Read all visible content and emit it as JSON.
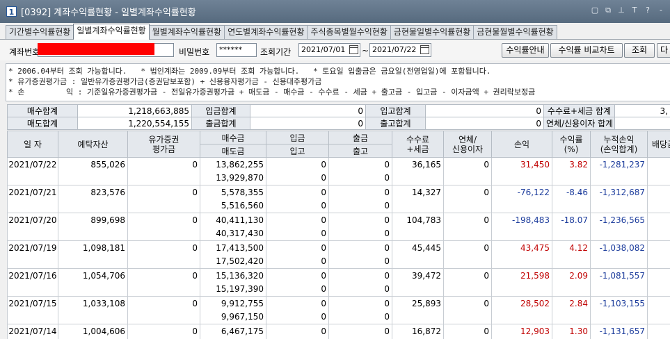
{
  "window": {
    "number": "1",
    "title": "[0392] 계좌수익률현황 - 일별계좌수익률현황",
    "tool_icons": [
      "▢",
      "⧉",
      "⊥",
      "T",
      "?",
      "-"
    ]
  },
  "tabs": [
    {
      "label": "기간별수익률현황",
      "active": false
    },
    {
      "label": "일별계좌수익률현황",
      "active": true
    },
    {
      "label": "월별계좌수익률현황",
      "active": false
    },
    {
      "label": "연도별계좌수익률현황",
      "active": false
    },
    {
      "label": "주식종목별월수익현황",
      "active": false
    },
    {
      "label": "금현물일별수익률현황",
      "active": false
    },
    {
      "label": "금현물월별수익률현황",
      "active": false
    }
  ],
  "search": {
    "account_label": "계좌번호",
    "password_label": "비밀번호",
    "password_value": "******",
    "period_label": "조회기간",
    "date_from": "2021/07/01",
    "date_sep": "~",
    "date_to": "2021/07/22",
    "guide_button": "수익률안내",
    "compare_button": "수익률 비교차트",
    "query_button": "조회",
    "next_button": "다"
  },
  "notes": [
    "* 2006.04부터 조회 가능합니다.   * 법인계좌는 2009.09부터 조회 가능합니다.   * 토요일 입출금은 금요일(전영업일)에 포함됩니다.",
    "* 유가증권평가금 : 일반유가증권평가금(증권담보포함) + 신용융자평가금 - 신용대주평가금",
    "* 손         익 : 기준일유가증권평가금 - 전일유가증권평가금 + 매도금 - 매수금 - 수수료 - 세금 + 출고금 - 입고금 - 이자금액 + 권리락보정금"
  ],
  "summary": {
    "row1": [
      {
        "label": "매수합계",
        "value": "1,218,663,885"
      },
      {
        "label": "입금합계",
        "value": "0"
      },
      {
        "label": "입고합계",
        "value": "0"
      },
      {
        "label": "수수료+세금 합계",
        "value": "3,"
      }
    ],
    "row2": [
      {
        "label": "매도합계",
        "value": "1,220,554,155"
      },
      {
        "label": "출금합계",
        "value": "0"
      },
      {
        "label": "출고합계",
        "value": "0"
      },
      {
        "label": "연체/신용이자 합계",
        "value": ""
      }
    ]
  },
  "grid": {
    "headers": {
      "date": "일 자",
      "deposit": "예탁자산",
      "securities": "유가증권\n평가금",
      "buy": "매수금",
      "sell": "매도금",
      "deposit_in": "입금",
      "securities_in": "입고",
      "withdraw": "출금",
      "securities_out": "출고",
      "fee": "수수료\n+세금",
      "interest": "연체/\n신용이자",
      "profit": "손익",
      "rate": "수익률\n(%)",
      "cumulative": "누적손익\n(손익합계)",
      "dividend": "배당금액"
    },
    "rows": [
      {
        "date": "2021/07/22",
        "deposit": "855,026",
        "securities": "0",
        "buy": "13,862,255",
        "sell": "13,929,870",
        "in": "0",
        "in2": "0",
        "out": "0",
        "out2": "0",
        "fee": "36,165",
        "interest": "0",
        "profit": "31,450",
        "rate": "3.82",
        "cumulative": "-1,281,237",
        "dividend": "",
        "sign": "pos"
      },
      {
        "date": "2021/07/21",
        "deposit": "823,576",
        "securities": "0",
        "buy": "5,578,355",
        "sell": "5,516,560",
        "in": "0",
        "in2": "0",
        "out": "0",
        "out2": "0",
        "fee": "14,327",
        "interest": "0",
        "profit": "-76,122",
        "rate": "-8.46",
        "cumulative": "-1,312,687",
        "dividend": "",
        "sign": "neg"
      },
      {
        "date": "2021/07/20",
        "deposit": "899,698",
        "securities": "0",
        "buy": "40,411,130",
        "sell": "40,317,430",
        "in": "0",
        "in2": "0",
        "out": "0",
        "out2": "0",
        "fee": "104,783",
        "interest": "0",
        "profit": "-198,483",
        "rate": "-18.07",
        "cumulative": "-1,236,565",
        "dividend": "",
        "sign": "neg"
      },
      {
        "date": "2021/07/19",
        "deposit": "1,098,181",
        "securities": "0",
        "buy": "17,413,500",
        "sell": "17,502,420",
        "in": "0",
        "in2": "0",
        "out": "0",
        "out2": "0",
        "fee": "45,445",
        "interest": "0",
        "profit": "43,475",
        "rate": "4.12",
        "cumulative": "-1,038,082",
        "dividend": "",
        "sign": "pos"
      },
      {
        "date": "2021/07/16",
        "deposit": "1,054,706",
        "securities": "0",
        "buy": "15,136,320",
        "sell": "15,197,390",
        "in": "0",
        "in2": "0",
        "out": "0",
        "out2": "0",
        "fee": "39,472",
        "interest": "0",
        "profit": "21,598",
        "rate": "2.09",
        "cumulative": "-1,081,557",
        "dividend": "",
        "sign": "pos"
      },
      {
        "date": "2021/07/15",
        "deposit": "1,033,108",
        "securities": "0",
        "buy": "9,912,755",
        "sell": "9,967,150",
        "in": "0",
        "in2": "0",
        "out": "0",
        "out2": "0",
        "fee": "25,893",
        "interest": "0",
        "profit": "28,502",
        "rate": "2.84",
        "cumulative": "-1,103,155",
        "dividend": "",
        "sign": "pos"
      },
      {
        "date": "2021/07/14",
        "deposit": "1,004,606",
        "securities": "0",
        "buy": "6,467,175",
        "sell": "",
        "in": "0",
        "in2": "",
        "out": "0",
        "out2": "",
        "fee": "16,872",
        "interest": "0",
        "profit": "12,903",
        "rate": "1.30",
        "cumulative": "-1,131,657",
        "dividend": "",
        "sign": "pos"
      }
    ]
  },
  "colors": {
    "profit_positive": "#c00000",
    "profit_negative": "#1c3c9c",
    "titlebar": "#62768a"
  }
}
